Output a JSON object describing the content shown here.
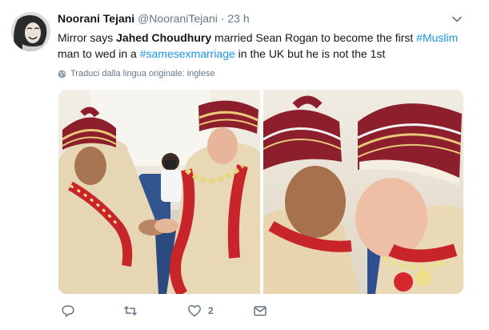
{
  "tweet": {
    "author_name": "Noorani Tejani",
    "author_handle": "@NooraniTejani",
    "separator": "·",
    "timestamp": "23 h",
    "text_segments": {
      "t1": "Mirror says ",
      "t2": "Jahed Choudhury",
      "t3": " married Sean Rogan  to become the first ",
      "t4": "#Muslim",
      "t5": "man to wed in a ",
      "t6": "#samesexmarriage",
      "t7": " in the UK but he is not the 1st"
    },
    "translate_label": "Traduci dalla lingua originale: inglese",
    "actions": {
      "reply_count": "",
      "retweet_count": "",
      "like_count": "2"
    },
    "icons": {
      "avatar": "avatar-photo",
      "caret": "chevron-down-icon",
      "globe": "globe-icon",
      "reply": "reply-icon",
      "retweet": "retweet-icon",
      "like": "heart-icon",
      "message": "envelope-icon"
    },
    "colors": {
      "link": "#1b95e0",
      "secondary": "#657786"
    }
  }
}
